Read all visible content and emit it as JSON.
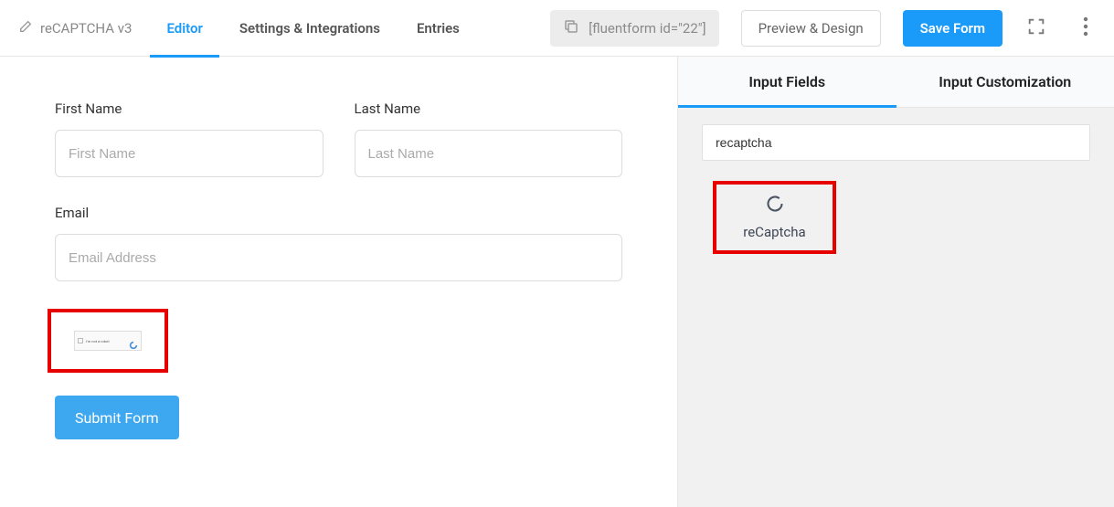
{
  "header": {
    "form_title": "reCAPTCHA v3",
    "nav": {
      "editor": "Editor",
      "settings": "Settings & Integrations",
      "entries": "Entries"
    },
    "shortcode": "[fluentform id=\"22\"]",
    "preview_label": "Preview & Design",
    "save_label": "Save Form"
  },
  "form": {
    "first_name": {
      "label": "First Name",
      "placeholder": "First Name",
      "value": ""
    },
    "last_name": {
      "label": "Last Name",
      "placeholder": "Last Name",
      "value": ""
    },
    "email": {
      "label": "Email",
      "placeholder": "Email Address",
      "value": ""
    },
    "recaptcha_widget_text": "I'm not a robot",
    "submit_label": "Submit Form"
  },
  "panel": {
    "tabs": {
      "input_fields": "Input Fields",
      "customization": "Input Customization"
    },
    "search_value": "recaptcha",
    "result": {
      "label": "reCaptcha"
    }
  }
}
